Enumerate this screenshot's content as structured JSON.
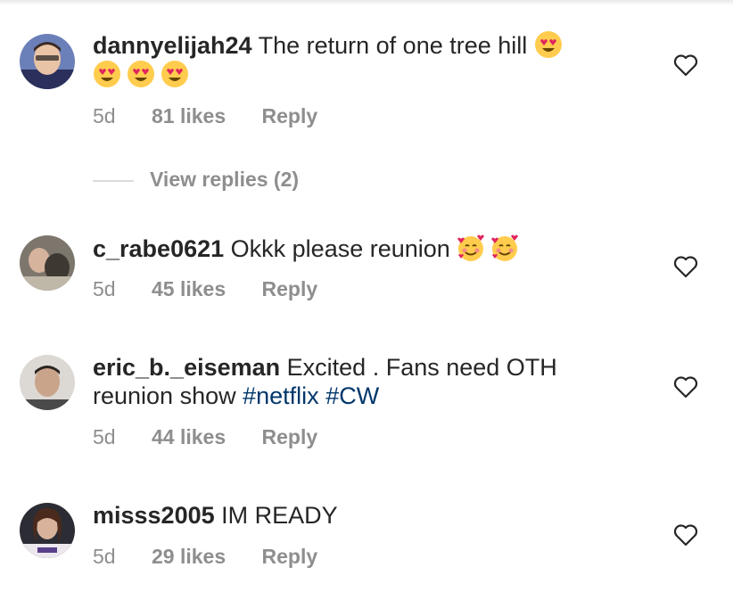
{
  "comments": [
    {
      "username": "dannyelijah24",
      "text": "The return of one tree hill",
      "emoji_after_text": [
        "heart-eyes-emoji"
      ],
      "emoji_line2": [
        "heart-eyes-emoji",
        "heart-eyes-emoji",
        "heart-eyes-emoji"
      ],
      "time": "5d",
      "likes": "81 likes",
      "reply": "Reply"
    },
    {
      "username": "c_rabe0621",
      "text": "Okkk please reunion",
      "emoji_after_text": [
        "smiling-face-with-hearts-emoji",
        "smiling-face-with-hearts-emoji"
      ],
      "time": "5d",
      "likes": "45 likes",
      "reply": "Reply"
    },
    {
      "username": "eric_b._eiseman",
      "text": "Excited . Fans need OTH reunion show",
      "hashtags": [
        "#netflix",
        "#CW"
      ],
      "time": "5d",
      "likes": "44 likes",
      "reply": "Reply"
    },
    {
      "username": "misss2005",
      "text": "IM READY",
      "time": "5d",
      "likes": "29 likes",
      "reply": "Reply"
    }
  ],
  "view_replies": "View replies (2)",
  "colors": {
    "text": "#262626",
    "muted": "#8e8e8e",
    "hashtag": "#00376b",
    "divider": "#dbdbdb"
  }
}
